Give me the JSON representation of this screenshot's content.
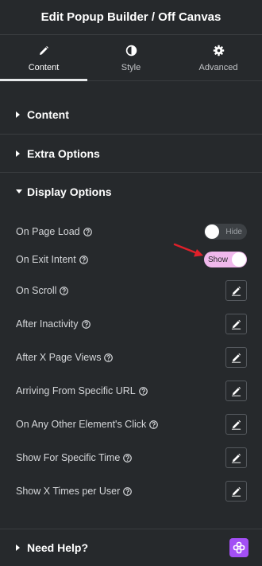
{
  "header": {
    "title": "Edit Popup Builder / Off Canvas"
  },
  "tabs": [
    {
      "label": "Content",
      "icon": "pencil-icon",
      "active": true
    },
    {
      "label": "Style",
      "icon": "half-circle-icon",
      "active": false
    },
    {
      "label": "Advanced",
      "icon": "gear-icon",
      "active": false
    }
  ],
  "sections": {
    "content": "Content",
    "extra": "Extra Options",
    "display": "Display Options",
    "help": "Need Help?"
  },
  "display_options": {
    "page_load": {
      "label": "On Page Load",
      "toggle_text": "Hide",
      "state": "off"
    },
    "exit_intent": {
      "label": "On Exit Intent",
      "toggle_text": "Show",
      "state": "on"
    },
    "rows": [
      "On Scroll",
      "After Inactivity",
      "After X Page Views",
      "Arriving From Specific URL",
      "On Any Other Element's Click",
      "Show For Specific Time",
      "Show X Times per User"
    ]
  },
  "colors": {
    "background": "#26292c",
    "toggle_on": "#f0b8ec",
    "help_badge": "#a34ff5",
    "arrow": "#e0202a"
  }
}
